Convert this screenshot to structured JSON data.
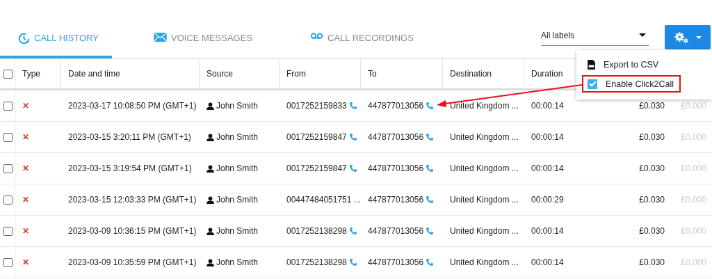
{
  "tabs": [
    {
      "label": "CALL HISTORY",
      "kind": "history",
      "selected": true
    },
    {
      "label": "VOICE MESSAGES",
      "kind": "mail",
      "selected": false
    },
    {
      "label": "CALL RECORDINGS",
      "kind": "voicemail",
      "selected": false
    }
  ],
  "label_filter": {
    "value": "All labels"
  },
  "settings_menu": {
    "expanded": true,
    "items": [
      {
        "label": "Export to CSV",
        "kind": "file"
      },
      {
        "label": "Enable Click2Call",
        "kind": "checkbox",
        "checked": true,
        "highlighted": true
      }
    ]
  },
  "annotation": {
    "arrow": true
  },
  "table": {
    "select_all": {
      "checked": false
    },
    "columns": [
      "Type",
      "Date and time",
      "Source",
      "From",
      "To",
      "Destination",
      "Duration"
    ],
    "rows": [
      {
        "checked": false,
        "type": "✕",
        "date": "2023-03-17 10:08:50 PM (GMT+1)",
        "source": "John Smith",
        "from": "0017252159833",
        "from_call": true,
        "to": "447877013056",
        "to_call": true,
        "destination": "United Kingdom ...",
        "duration": "00:00:14",
        "column_8": "£0.030",
        "column_9": "£0.000"
      },
      {
        "checked": false,
        "type": "✕",
        "date": "2023-03-15 3:20:11 PM (GMT+1)",
        "source": "John Smith",
        "from": "0017252159847",
        "from_call": true,
        "to": "447877013056",
        "to_call": true,
        "destination": "United Kingdom ...",
        "duration": "00:00:14",
        "column_8": "£0.030",
        "column_9": "£0.000"
      },
      {
        "checked": false,
        "type": "✕",
        "date": "2023-03-15 3:19:54 PM (GMT+1)",
        "source": "John Smith",
        "from": "0017252159847",
        "from_call": true,
        "to": "447877013056",
        "to_call": true,
        "destination": "United Kingdom ...",
        "duration": "00:00:14",
        "column_8": "£0.030",
        "column_9": "£0.000"
      },
      {
        "checked": false,
        "type": "✕",
        "date": "2023-03-15 12:03:33 PM (GMT+1)",
        "source": "John Smith",
        "from": "00447484051751 ...",
        "from_call": false,
        "to": "447877013056",
        "to_call": true,
        "destination": "United Kingdom ...",
        "duration": "00:00:29",
        "column_8": "£0.030",
        "column_9": "£0.000"
      },
      {
        "checked": false,
        "type": "✕",
        "date": "2023-03-09 10:36:15 PM (GMT+1)",
        "source": "John Smith",
        "from": "0017252138298",
        "from_call": true,
        "to": "447877013056",
        "to_call": true,
        "destination": "United Kingdom ...",
        "duration": "00:00:14",
        "column_8": "£0.030",
        "column_9": "£0.000"
      },
      {
        "checked": false,
        "type": "✕",
        "date": "2023-03-09 10:35:59 PM (GMT+1)",
        "source": "John Smith",
        "from": "0017252138298",
        "from_call": true,
        "to": "447877013056",
        "to_call": true,
        "destination": "United Kingdom ...",
        "duration": "00:00:14",
        "column_8": "£0.030",
        "column_9": "£0.000"
      }
    ]
  }
}
